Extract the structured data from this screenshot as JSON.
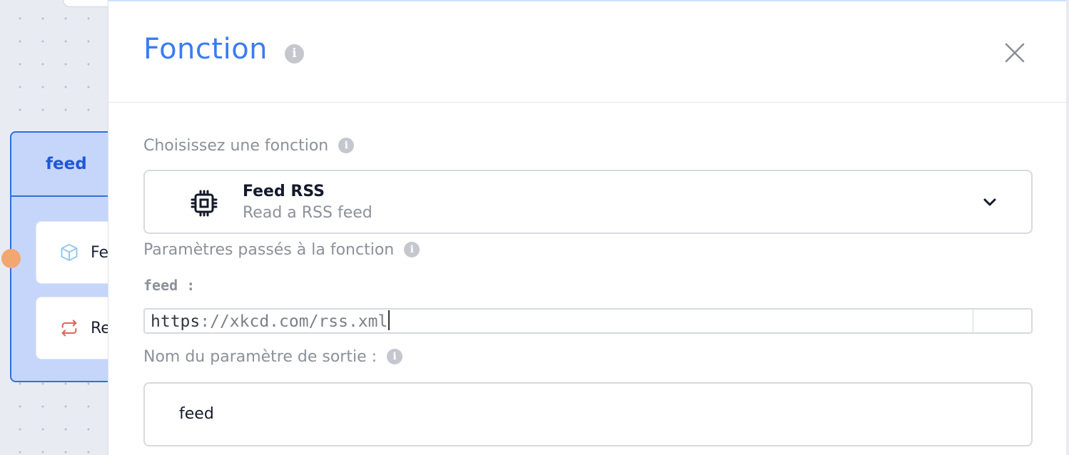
{
  "canvas": {
    "node": {
      "header": "feed",
      "items": [
        {
          "label": "Fe",
          "icon": "cube-icon",
          "icon_color": "#8fc7ea"
        },
        {
          "label": "Re",
          "icon": "repeat-icon",
          "icon_color": "#e0645d"
        }
      ]
    }
  },
  "drawer": {
    "title": "Fonction",
    "close_icon": "close-icon",
    "choose_label": "Choisissez une fonction",
    "selected_function": {
      "name": "Feed RSS",
      "description": "Read a RSS feed",
      "icon": "chip-icon"
    },
    "params_label": "Paramètres passés à la fonction",
    "param_name": "feed :",
    "param_value_prefix": "https",
    "param_value_rest": "://xkcd.com/rss.xml",
    "output_label": "Nom du paramètre de sortie :",
    "output_value": "feed",
    "info_glyph": "i"
  },
  "colors": {
    "accent": "#3b7cf2",
    "node_border": "#2f6fe4",
    "node_fill": "#c6d6fb",
    "port": "#f2a670"
  }
}
